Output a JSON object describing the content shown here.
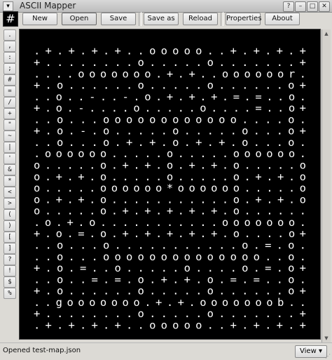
{
  "window": {
    "title": "ASCII Mapper",
    "controls": [
      "?",
      "–",
      "□",
      "✕"
    ]
  },
  "toolbar": {
    "hash_label": "#",
    "buttons": [
      {
        "label": "New"
      },
      {
        "label": "Open"
      },
      {
        "label": "Save"
      },
      {
        "label": "Save as"
      },
      {
        "label": "Reload"
      },
      {
        "label": "Properties"
      },
      {
        "label": "About"
      }
    ]
  },
  "palette": [
    ".",
    ",",
    ":",
    ";",
    "#",
    "=",
    "/",
    "+",
    "\"",
    "~",
    "|",
    "'",
    "&",
    "*",
    "<",
    ">",
    "(",
    ")",
    "[",
    "]",
    "?",
    "!",
    "$",
    "%"
  ],
  "map": {
    "rows": [
      ". + . + . + . + . . o o o o o . . + . + . + . +",
      "+ . . . . . . . . o . . . . . o . . . . . . . +",
      ". . . . o o o o o o o . + . + . . o o o o o o r .",
      "+ . o . . . . . . o . . . . . o . . . . . . o +",
      ". . o . . - . . - . o . + . + . + . = . = . . o .",
      "+ . o . - . . . . o . . . . . o . . . . = . . o +",
      ". . o . . . o o o o o o o o o o o o . . . . o .",
      "+ . o . - . o . . . . . o . . . . . o . . . o +",
      ". . o . . . o . + . + . o . + . + . o . . . o .",
      ". o o o o o o . . . . . o . . . . . o o o o o o .",
      "o . . . . . o . + . + . o . + . + . o . . . . . o",
      "o . + . + . o . . . . . o . . . . . o . + . + . o",
      "o . . . . . o o o o o o * o o o o o o . . . . . o",
      "o . + . + . o . . . . . . . . . . . o . + . + . o",
      "o . . . . . o . + . + . + . + . + . o . . . . . .",
      ". o . + . o . . . . . . . . . . . o o o o o o o .",
      "+ . o . = . o . + . + . + . + . + . o . . . . o +",
      ". . o . . . o . . . . . . . . . . . o . = . o .",
      ". . o . . . o o o o o o o o o o o o o o . . o .",
      "+ . o . = . . o . . . . . o . . . . o . = . o +",
      ". . o . . = . = . o . + . + . o . = . = . . o .",
      "+ . o . . . . . . o . . . . . o . . . . . . o +",
      ". . g o o o o o o o . + . + . o o o o o o o b . .",
      "+ . . . . . . . . o . . . . . o . . . . . . . +",
      ". + . + . + . + . . o o o o o . . + . + . + . +"
    ]
  },
  "status": {
    "message": "Opened test-map.json",
    "view_label": "View"
  }
}
